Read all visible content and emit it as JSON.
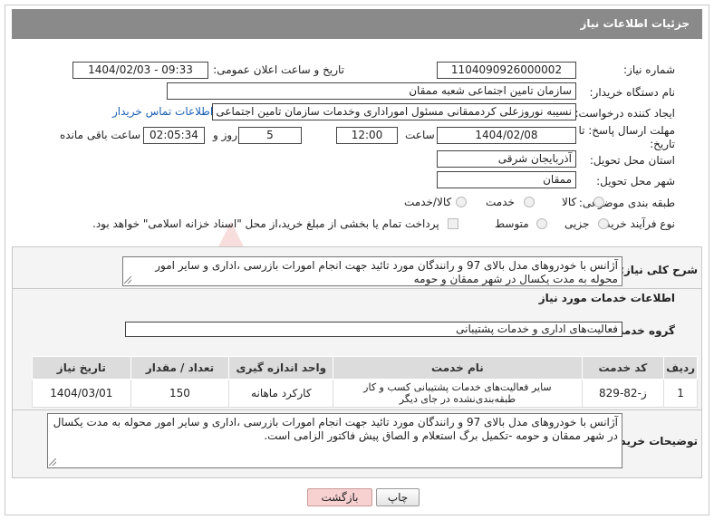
{
  "header": {
    "title": "جزئیات اطلاعات نیاز"
  },
  "form": {
    "need_number_label": "شماره نیاز:",
    "need_number": "1104090926000002",
    "announce_label": "تاریخ و ساعت اعلان عمومی:",
    "announce_value": "1404/02/03 - 09:33",
    "buyer_org_label": "نام دستگاه خریدار:",
    "buyer_org": "سازمان تامین اجتماعی شعبه ممقان",
    "creator_label": "ایجاد کننده درخواست:",
    "creator": "نسیبه  نوروزعلی کردممقانی مسئول اموراداری وخدمات  سازمان تامین اجتماعی",
    "contact_link": "اطلاعات تماس خریدار",
    "deadline_label_1": "مهلت ارسال پاسخ: تا",
    "deadline_label_2": "تاریخ:",
    "deadline_date": "1404/02/08",
    "time_label": "ساعت",
    "deadline_time": "12:00",
    "days_value": "5",
    "days_label": "روز و",
    "remaining_time": "02:05:34",
    "remaining_label": "ساعت باقی مانده",
    "province_label": "استان محل تحویل:",
    "province": "آذربایجان شرقی",
    "city_label": "شهر محل تحویل:",
    "city": "ممقان",
    "category_label": "طبقه بندی موضوعی:",
    "category_options": [
      "کالا",
      "خدمت",
      "کالا/خدمت"
    ],
    "category_selected": "خدمت",
    "process_label": "نوع فرآیند خرید :",
    "process_options": [
      "جزیی",
      "متوسط"
    ],
    "process_selected": "جزیی",
    "payment_note": "پرداخت تمام یا بخشی از مبلغ خرید،از محل \"اسناد خزانه اسلامی\" خواهد بود."
  },
  "summary": {
    "label": "شرح کلی نیاز:",
    "text": "آژانس با خودروهای مدل بالای 97 و رانندگان مورد تائید جهت انجام امورات بازرسی ،اداری و سایر امور محوله به مدت یکسال در شهر ممقان و حومه"
  },
  "services": {
    "section_title": "اطلاعات خدمات مورد نیاز",
    "group_label": "گروه خدمت:",
    "group_value": "فعالیت‌های اداری و خدمات پشتیبانی",
    "columns": [
      "ردیف",
      "کد خدمت",
      "نام خدمت",
      "واحد اندازه گیری",
      "تعداد / مقدار",
      "تاریخ نیاز"
    ],
    "rows": [
      [
        "1",
        "ز-82-829",
        "سایر فعالیت‌های خدمات پشتیبانی کسب و کار طبقه‌بندی‌نشده در جای دیگر",
        "کارکرد ماهانه",
        "150",
        "1404/03/01"
      ]
    ]
  },
  "buyer_notes": {
    "label": "توضیحات خریدار:",
    "text": "آژانس با خودروهای مدل بالای 97 و رانندگان مورد تائید جهت انجام امورات بازرسی ،اداری و سایر امور محوله به مدت یکسال در شهر ممقان و حومه -تکمیل برگ استعلام و الصاق پیش فاکتور الزامی است."
  },
  "buttons": {
    "print": "چاپ",
    "back": "بازگشت"
  },
  "colors": {
    "header_bg": "#8a8a8a",
    "link": "#1a5fb4",
    "back_button_bg": "#f7d0d0"
  }
}
